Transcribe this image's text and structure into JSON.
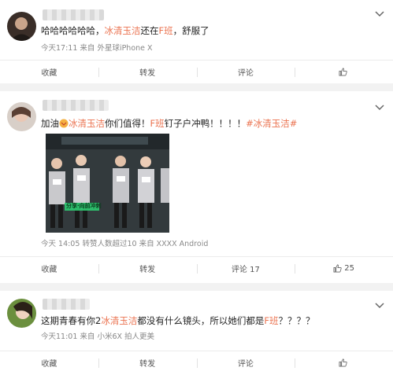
{
  "posts": [
    {
      "segments": [
        "哈哈哈哈哈哈，",
        "冰清玉洁",
        "还在",
        "F班",
        "，舒服了"
      ],
      "meta_time": "今天17:11",
      "meta_source": "来自 外星球iPhone X",
      "actions": {
        "collect": "收藏",
        "repost": "转发",
        "comment": "评论",
        "like": ""
      }
    },
    {
      "segments": [
        "加油",
        "冰清玉洁",
        "你们值得！",
        "F班",
        "钉子户冲鸭！！！！",
        "#冰清玉洁#"
      ],
      "image_caption": "分享·向前冲刺",
      "meta_time": "今天 14:05",
      "meta_reposts": "转赞人数超过10",
      "meta_source": "来自 XXXX Android",
      "actions": {
        "collect": "收藏",
        "repost": "转发",
        "comment": "评论 17",
        "like": "25"
      }
    },
    {
      "segments": [
        "这期青春有你2",
        "冰清玉洁",
        "都没有什么镜头，所以她们都是",
        "F班",
        "？？？？"
      ],
      "meta_time": "今天11:01",
      "meta_source": "来自 小米6X 拍人更美",
      "actions": {
        "collect": "收藏",
        "repost": "转发",
        "comment": "评论",
        "like": ""
      }
    }
  ],
  "colors": {
    "highlight": "#eb7350",
    "meta": "#888888",
    "background": "#f2f2f2"
  },
  "icons": {
    "menu": "chevron-down-icon",
    "like": "thumbs-up-icon"
  }
}
